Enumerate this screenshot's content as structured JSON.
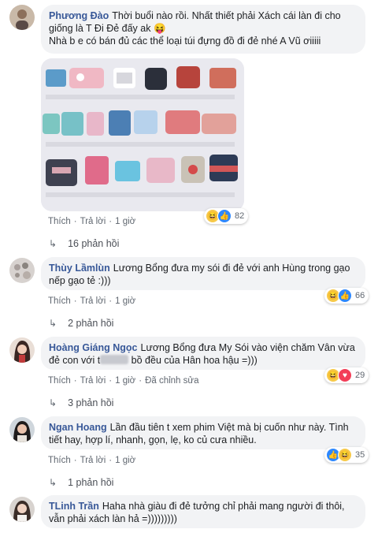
{
  "comments": [
    {
      "author": "Phương Đào",
      "text": "Thời buổi nào rồi. Nhất thiết phải Xách cái làn đi cho giống là T Đi Đẻ đấy ak 😝\nNhà b e có bán đủ các thể loại túi đựng đồ đi đẻ nhé A Vũ ơiiiii",
      "actions": {
        "like": "Thích",
        "reply": "Trả lời",
        "time": "1 giờ"
      },
      "reactions_count": "82",
      "replies": "16 phản hồi"
    },
    {
      "author": "Thùy Lầmlùn",
      "text": "Lương Bổng đưa my sói đi đẻ với anh Hùng trong gạo nếp gạo tẻ :)))",
      "actions": {
        "like": "Thích",
        "reply": "Trả lời",
        "time": "1 giờ"
      },
      "reactions_count": "66",
      "replies": "2 phản hồi"
    },
    {
      "author": "Hoàng Giáng Ngọc",
      "text_a": "Lương Bổng đưa My Sói vào viện chăm Vân vừa đẻ con với t",
      "text_b": " bồ đều của Hân hoa hậu =)))",
      "actions": {
        "like": "Thích",
        "reply": "Trả lời",
        "time": "1 giờ",
        "edited": "Đã chỉnh sửa"
      },
      "reactions_count": "29",
      "replies": "3 phản hồi"
    },
    {
      "author": "Ngan Hoang",
      "text": "Lần đầu tiên t xem phim Việt mà bị cuốn như này. Tình tiết hay, hợp lí, nhanh, gọn, lẹ, ko củ cưa nhiều.",
      "actions": {
        "like": "Thích",
        "reply": "Trả lời",
        "time": "1 giờ"
      },
      "reactions_count": "35",
      "replies": "1 phản hồi"
    },
    {
      "author": "TLinh Trần",
      "text": "Haha nhà giàu đi đẻ tưởng chỉ phải mang người đi thôi, vẫn phải xách làn hả =)))))))))"
    }
  ],
  "icons": {
    "reply_arrow": "↳",
    "haha": "😆",
    "like": "👍",
    "love": "♥"
  },
  "colors": {
    "author": "#385898",
    "bubble": "#f2f3f5",
    "meta": "#606770"
  }
}
